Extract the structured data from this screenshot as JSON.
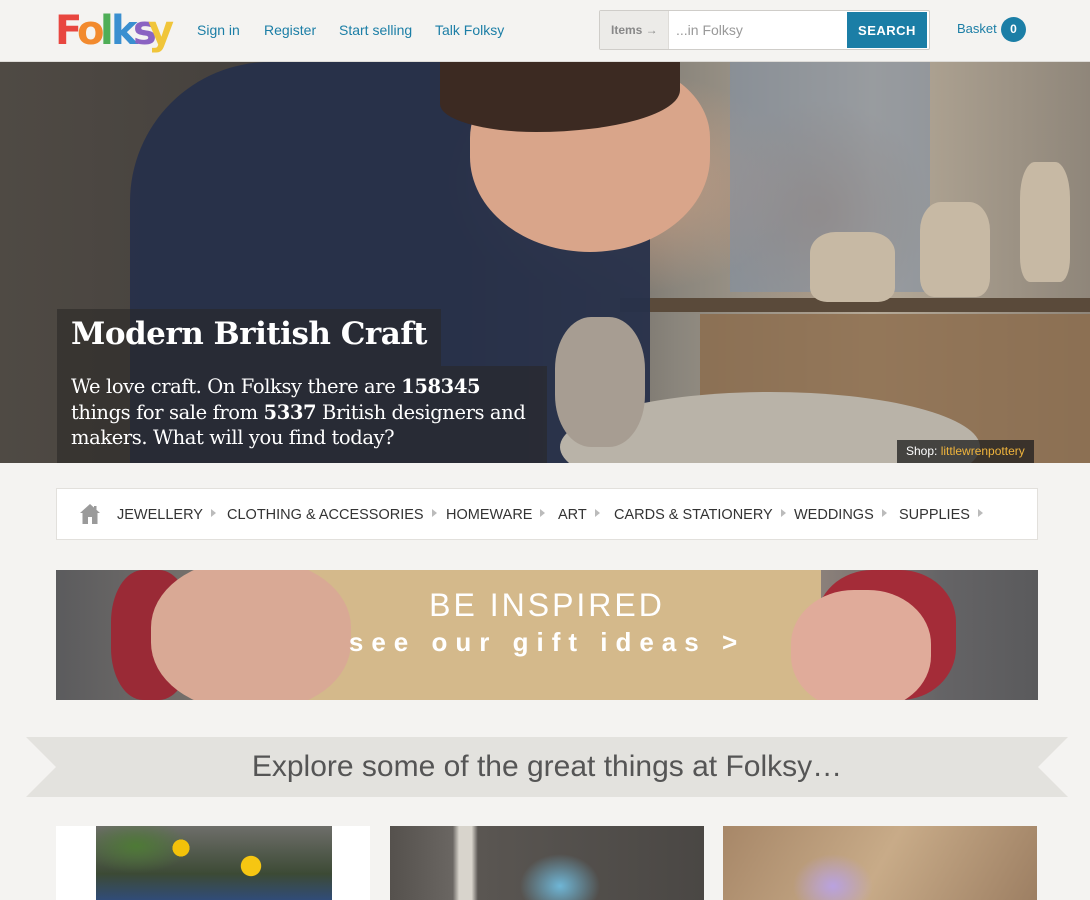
{
  "header": {
    "logo_text": "Folksy",
    "nav": [
      {
        "label": "Sign in"
      },
      {
        "label": "Register"
      },
      {
        "label": "Start selling"
      },
      {
        "label": "Talk Folksy"
      }
    ],
    "search": {
      "scope_label": "Items →",
      "placeholder": "...in Folksy",
      "button_label": "SEARCH"
    },
    "basket": {
      "label": "Basket",
      "count": "0"
    }
  },
  "hero": {
    "title": "Modern British Craft",
    "desc_prefix": "We love craft. On Folksy there are ",
    "items_count": "158345",
    "desc_mid": " things for sale from ",
    "makers_count": "5337",
    "desc_suffix": " British designers and makers. What will you find today?",
    "credit_label": "Shop: ",
    "credit_shop": "littlewrenpottery"
  },
  "categories": [
    {
      "label": "JEWELLERY"
    },
    {
      "label": "CLOTHING & ACCESSORIES"
    },
    {
      "label": "HOMEWARE"
    },
    {
      "label": "ART"
    },
    {
      "label": "CARDS & STATIONERY"
    },
    {
      "label": "WEDDINGS"
    },
    {
      "label": "SUPPLIES"
    }
  ],
  "banner": {
    "line1": "BE INSPIRED",
    "line2": "see our gift ideas >"
  },
  "section_title": "Explore some of the great things at Folksy…",
  "colors": {
    "accent": "#1b7ea6",
    "background": "#f4f3f1",
    "credit_link": "#f0b43c"
  }
}
